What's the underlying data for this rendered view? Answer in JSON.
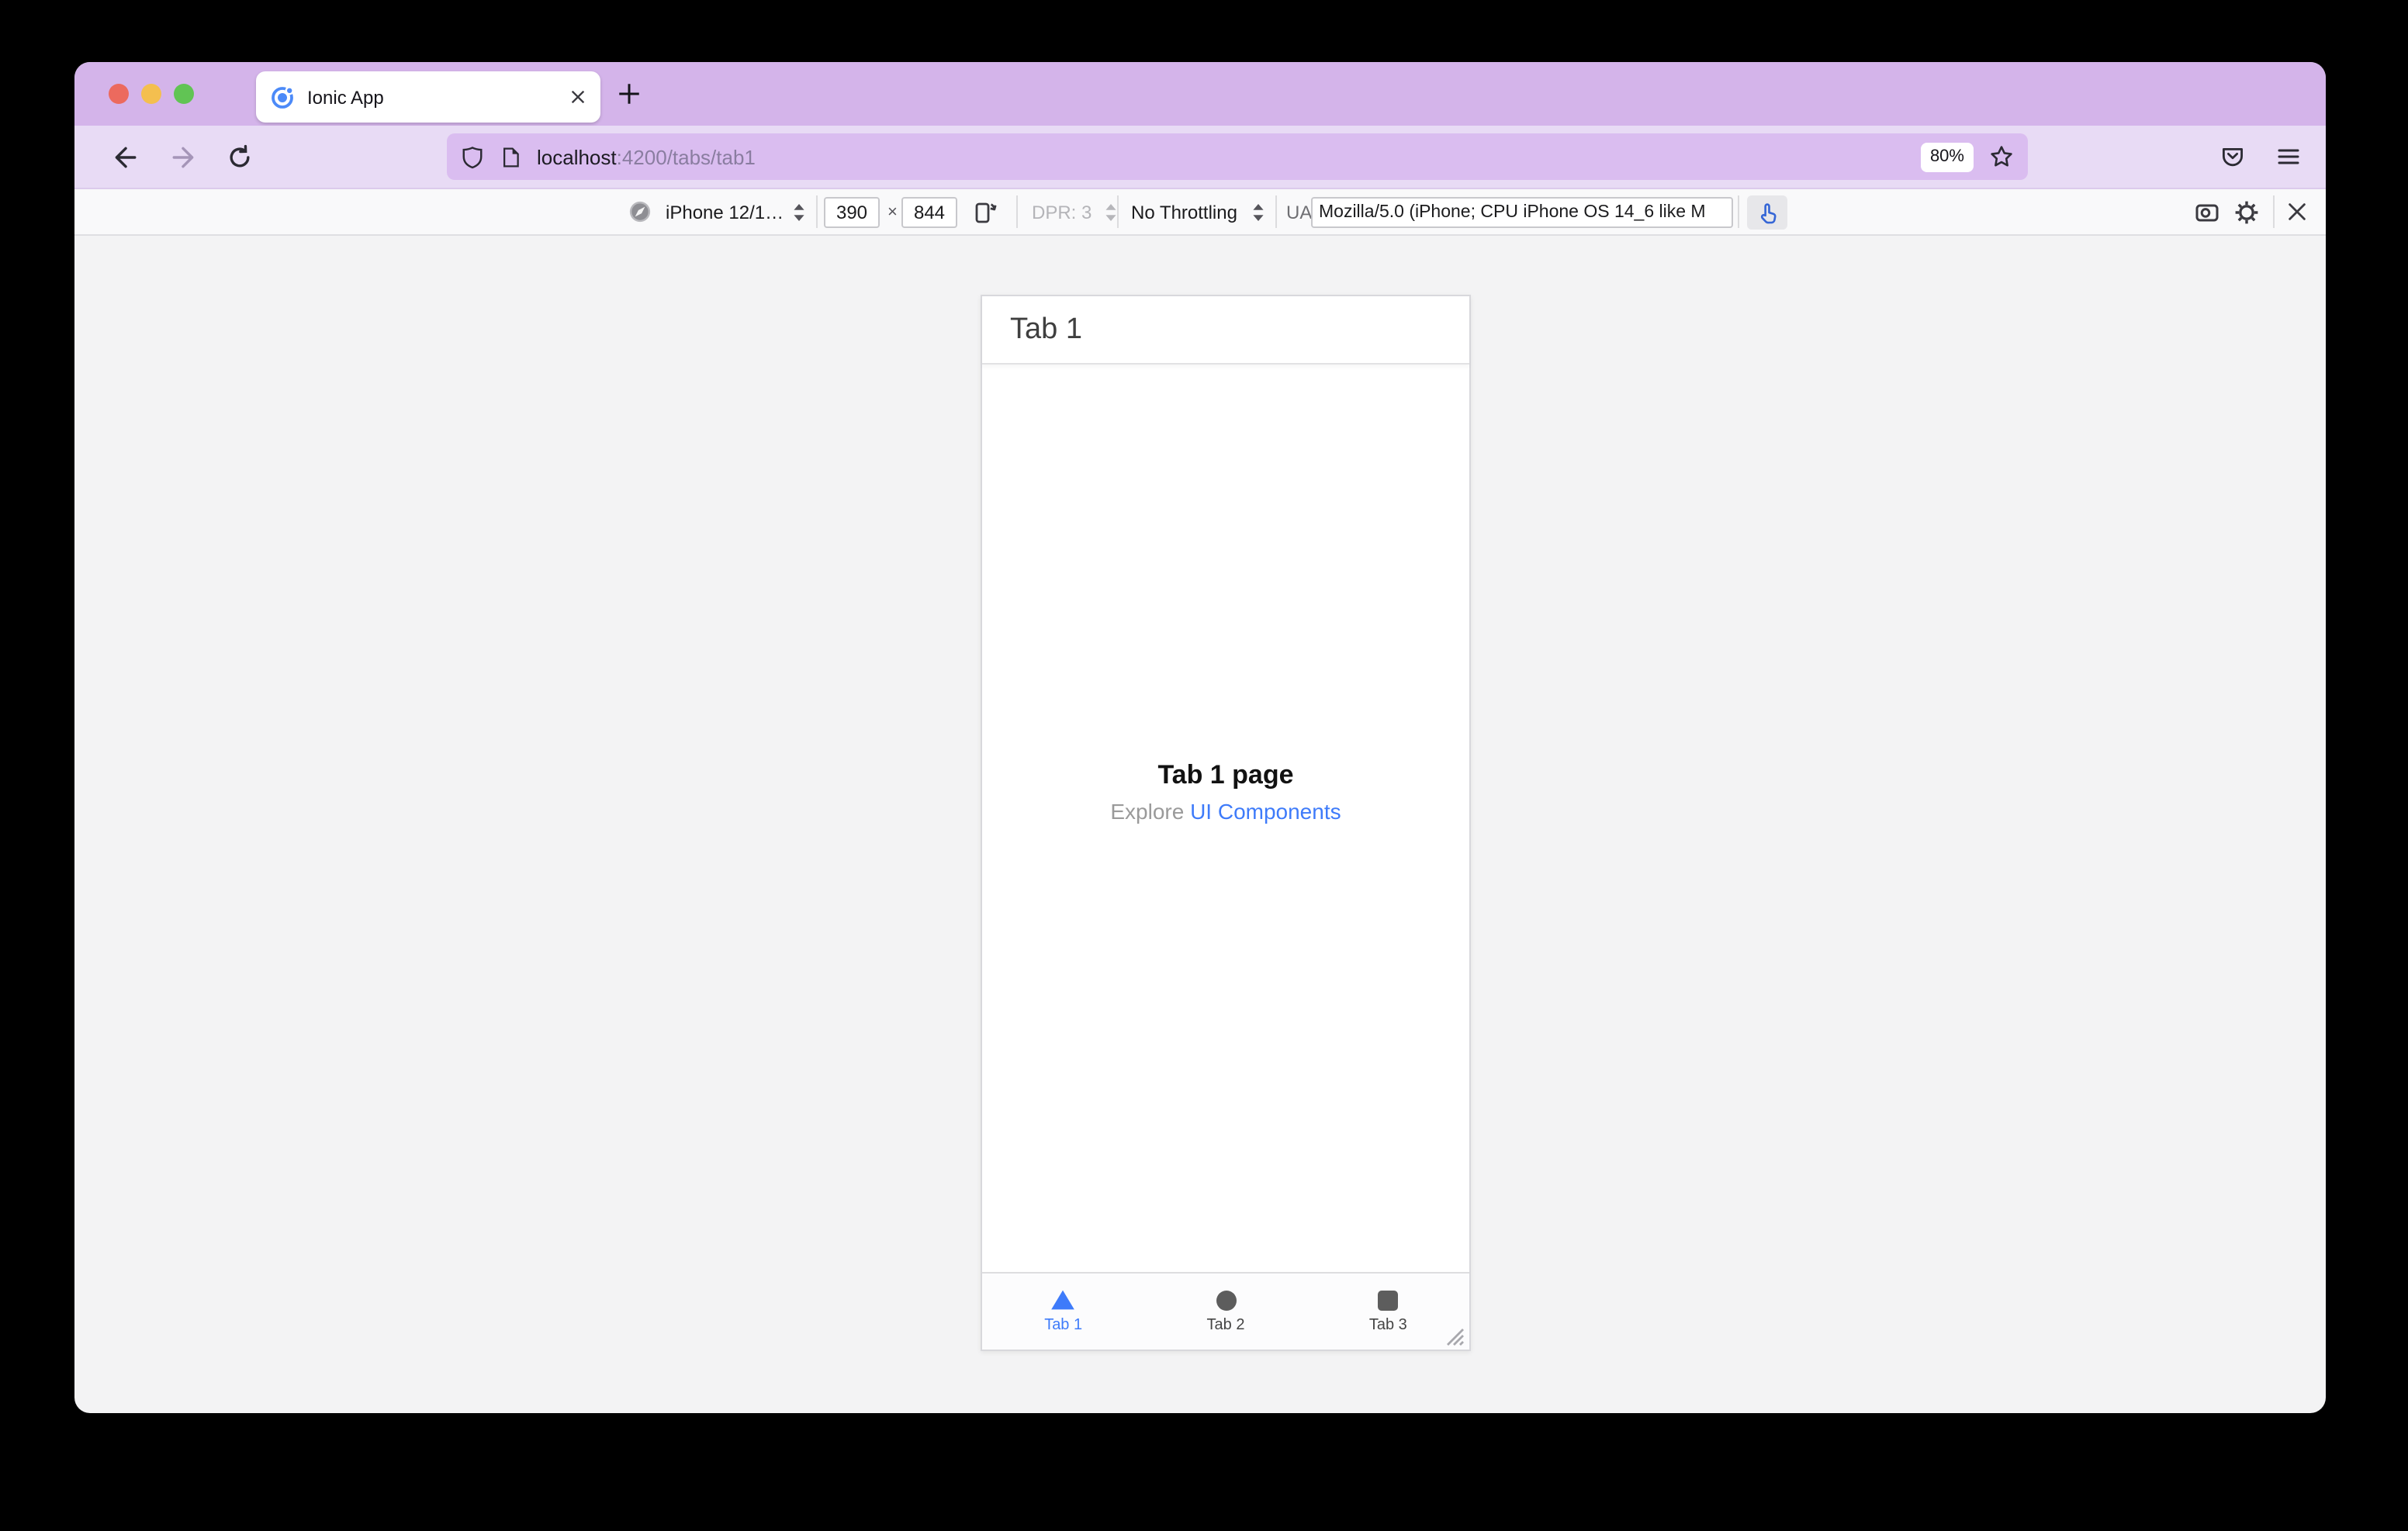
{
  "colors": {
    "accent-blue": "#3e7bfa",
    "chrome-strip": "#d4b4ea",
    "chrome-toolbar": "#e8dbf5",
    "urlbar-bg": "#dabdf0",
    "rdm-bg": "#f9f9fa",
    "content-bg": "#f3f3f4"
  },
  "titlebar": {
    "tab_title": "Ionic App"
  },
  "navbar": {
    "url_host": "localhost",
    "url_rest": ":4200/tabs/tab1",
    "zoom_badge": "80%"
  },
  "rdm": {
    "device": "iPhone 12/1…",
    "width": "390",
    "times": "×",
    "height": "844",
    "dpr": "DPR: 3",
    "throttling": "No Throttling",
    "ua_label": "UA:",
    "ua_value": "Mozilla/5.0 (iPhone; CPU iPhone OS 14_6 like M"
  },
  "app": {
    "header_title": "Tab 1",
    "page_title": "Tab 1 page",
    "subtitle_prefix": "Explore",
    "subtitle_link": "UI Components",
    "tabs": [
      {
        "label": "Tab 1"
      },
      {
        "label": "Tab 2"
      },
      {
        "label": "Tab 3"
      }
    ]
  }
}
